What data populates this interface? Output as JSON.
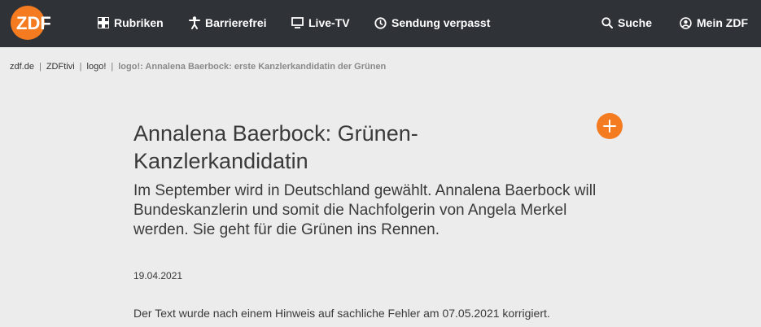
{
  "header": {
    "logo_text": "ZDF",
    "nav": [
      {
        "label": "Rubriken",
        "icon": "grid-icon"
      },
      {
        "label": "Barrierefrei",
        "icon": "accessibility-icon"
      },
      {
        "label": "Live-TV",
        "icon": "tv-icon"
      },
      {
        "label": "Sendung verpasst",
        "icon": "clock-icon"
      },
      {
        "label": "Suche",
        "icon": "search-icon"
      },
      {
        "label": "Mein ZDF",
        "icon": "user-icon"
      }
    ]
  },
  "breadcrumb": {
    "items": [
      "zdf.de",
      "ZDFtivi",
      "logo!"
    ],
    "separator": "|",
    "current": "logo!: Annalena Baerbock: erste Kanzlerkandidatin der Grünen"
  },
  "article": {
    "title": "Annalena Baerbock: Grünen-Kanzlerkandidatin",
    "subtitle": "Im September wird in Deutschland gewählt. Annalena Baerbock will Bundeskanzlerin und somit die Nachfolgerin von Angela Merkel werden. Sie geht für die Grünen ins Rennen.",
    "date": "19.04.2021",
    "note": "Der Text wurde nach einem Hinweis auf sachliche Fehler am 07.05.2021 korrigiert."
  },
  "colors": {
    "header_bg": "#2f3237",
    "brand_orange": "#f47b20",
    "page_bg": "#ececec"
  }
}
